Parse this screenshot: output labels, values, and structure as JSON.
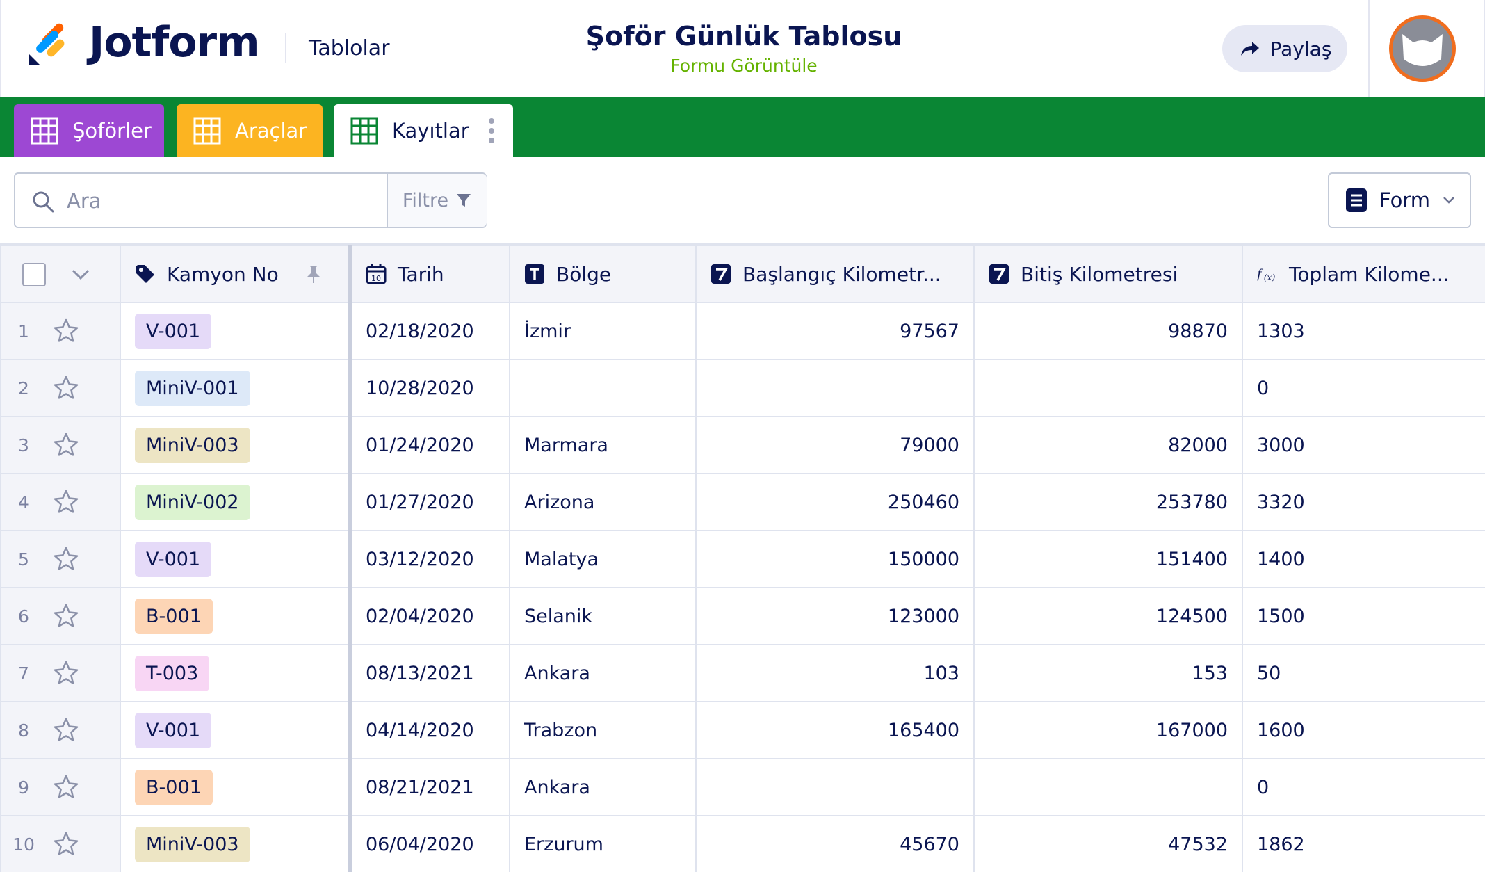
{
  "header": {
    "brand": "Jotform",
    "section_link": "Tablolar",
    "title": "Şoför Günlük Tablosu",
    "subtitle_link": "Formu Görüntüle",
    "share_label": "Paylaş"
  },
  "tabs": [
    {
      "label": "Şoförler",
      "color": "#9d48d3"
    },
    {
      "label": "Araçlar",
      "color": "#fcb421"
    },
    {
      "label": "Kayıtlar",
      "color": "#ffffff"
    }
  ],
  "toolbar": {
    "search_placeholder": "Ara",
    "filter_label": "Filtre",
    "view_label": "Form"
  },
  "columns": [
    {
      "label": "Kamyon No",
      "icon": "tag-icon"
    },
    {
      "label": "Tarih",
      "icon": "calendar-icon"
    },
    {
      "label": "Bölge",
      "icon": "text-type-icon"
    },
    {
      "label": "Başlangıç Kilometr...",
      "icon": "number-type-icon"
    },
    {
      "label": "Bitiş Kilometresi",
      "icon": "number-type-icon"
    },
    {
      "label": "Toplam Kilome...",
      "icon": "formula-icon"
    }
  ],
  "chip_colors": {
    "V-001": "#e5daf8",
    "MiniV-001": "#dde9f8",
    "MiniV-003": "#ede5c4",
    "MiniV-002": "#dcf3d0",
    "B-001": "#fdd5b5",
    "T-003": "#f8d6f4"
  },
  "rows": [
    {
      "n": "1",
      "truck": "V-001",
      "date": "02/18/2020",
      "region": "İzmir",
      "start": "97567",
      "end": "98870",
      "total": "1303"
    },
    {
      "n": "2",
      "truck": "MiniV-001",
      "date": "10/28/2020",
      "region": "",
      "start": "",
      "end": "",
      "total": "0"
    },
    {
      "n": "3",
      "truck": "MiniV-003",
      "date": "01/24/2020",
      "region": "Marmara",
      "start": "79000",
      "end": "82000",
      "total": "3000"
    },
    {
      "n": "4",
      "truck": "MiniV-002",
      "date": "01/27/2020",
      "region": "Arizona",
      "start": "250460",
      "end": "253780",
      "total": "3320"
    },
    {
      "n": "5",
      "truck": "V-001",
      "date": "03/12/2020",
      "region": "Malatya",
      "start": "150000",
      "end": "151400",
      "total": "1400"
    },
    {
      "n": "6",
      "truck": "B-001",
      "date": "02/04/2020",
      "region": "Selanik",
      "start": "123000",
      "end": "124500",
      "total": "1500"
    },
    {
      "n": "7",
      "truck": "T-003",
      "date": "08/13/2021",
      "region": "Ankara",
      "start": "103",
      "end": "153",
      "total": "50"
    },
    {
      "n": "8",
      "truck": "V-001",
      "date": "04/14/2020",
      "region": "Trabzon",
      "start": "165400",
      "end": "167000",
      "total": "1600"
    },
    {
      "n": "9",
      "truck": "B-001",
      "date": "08/21/2021",
      "region": "Ankara",
      "start": "",
      "end": "",
      "total": "0"
    },
    {
      "n": "10",
      "truck": "MiniV-003",
      "date": "06/04/2020",
      "region": "Erzurum",
      "start": "45670",
      "end": "47532",
      "total": "1862"
    }
  ]
}
